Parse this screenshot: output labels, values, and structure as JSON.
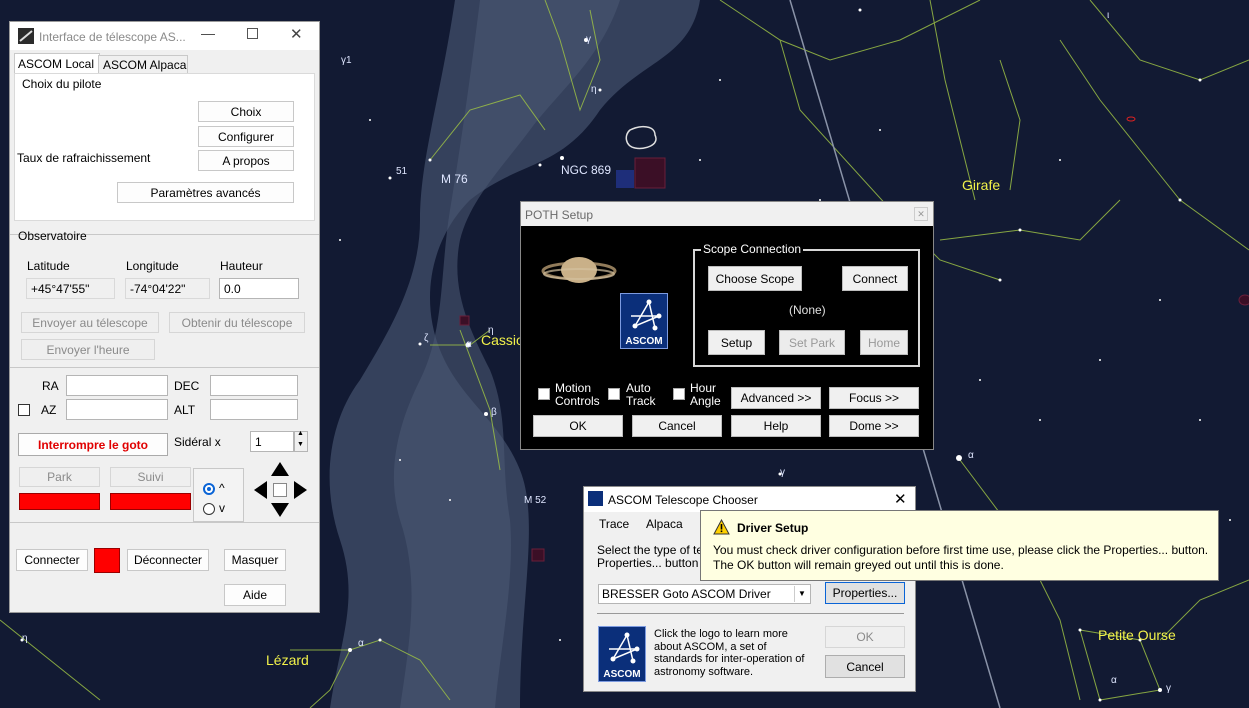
{
  "sky": {
    "constellations": [
      "Girafe",
      "Cassiopée",
      "Lézard",
      "Petite Ourse"
    ],
    "constellation_shown": [
      "Girafe",
      "Cassio",
      "Lézard",
      "Petite Ourse"
    ],
    "objects": [
      "M 76",
      "NGC 869",
      "M 52"
    ],
    "star_labels": [
      "γ1",
      "γ",
      "η",
      "51",
      "ζ",
      "α",
      "η",
      "β",
      "γ",
      "α",
      "α",
      "η",
      "α",
      "γ",
      "ι"
    ],
    "colors": {
      "background": "#121a33",
      "milky_way": "#3a4661",
      "lines": "#a0c84a",
      "labels": "#f2f24a"
    }
  },
  "tele": {
    "title": "Interface de télescope AS...",
    "tabs": [
      "ASCOM Local",
      "ASCOM Alpaca"
    ],
    "pilot": {
      "group": "Choix du pilote",
      "refresh_label": "Taux de rafraichissement",
      "choix": "Choix",
      "configurer": "Configurer",
      "apropos": "A propos",
      "avances": "Paramètres avancés"
    },
    "obs": {
      "group": "Observatoire",
      "lat_label": "Latitude",
      "lon_label": "Longitude",
      "alt_label": "Hauteur",
      "lat": "+45°47'55\"",
      "lon": "-74°04'22\"",
      "alt": "0.0",
      "send": "Envoyer au télescope",
      "get": "Obtenir du télescope",
      "send_time": "Envoyer l'heure"
    },
    "coords": {
      "ra": "RA",
      "dec": "DEC",
      "az": "AZ",
      "alt": "ALT"
    },
    "abort": "Interrompre le goto",
    "sidereal_label": "Sidéral x",
    "sidereal_value": "1",
    "park": "Park",
    "suivi": "Suivi",
    "dir_up": "^",
    "dir_down": "v",
    "connect": "Connecter",
    "disconnect": "Déconnecter",
    "hide": "Masquer",
    "help": "Aide",
    "status_color": "#ff0000"
  },
  "poth": {
    "title": "POTH Setup",
    "scope_group": "Scope Connection",
    "choose": "Choose Scope",
    "connect": "Connect",
    "none": "(None)",
    "setup": "Setup",
    "setpark": "Set Park",
    "home": "Home",
    "motion1": "Motion",
    "motion2": "Controls",
    "auto1": "Auto",
    "auto2": "Track",
    "hour1": "Hour",
    "hour2": "Angle",
    "advanced": "Advanced >>",
    "focus": "Focus >>",
    "ok": "OK",
    "cancel": "Cancel",
    "help": "Help",
    "dome": "Dome >>",
    "logo_text": "ASCOM"
  },
  "chooser": {
    "title": "ASCOM Telescope Chooser",
    "menu": [
      "Trace",
      "Alpaca"
    ],
    "desc1": "Select the type of tele",
    "desc2": "Properties... button to",
    "driver": "BRESSER Goto ASCOM Driver",
    "properties": "Properties...",
    "ok": "OK",
    "cancel": "Cancel",
    "about": "Click the logo to learn more about ASCOM, a set of standards for inter-operation of astronomy software.",
    "logo_text": "ASCOM"
  },
  "tooltip": {
    "title": "Driver Setup",
    "line1": "You must check driver configuration before first time use, please click the Properties... button.",
    "line2": "The OK button will remain greyed out until this is done."
  }
}
